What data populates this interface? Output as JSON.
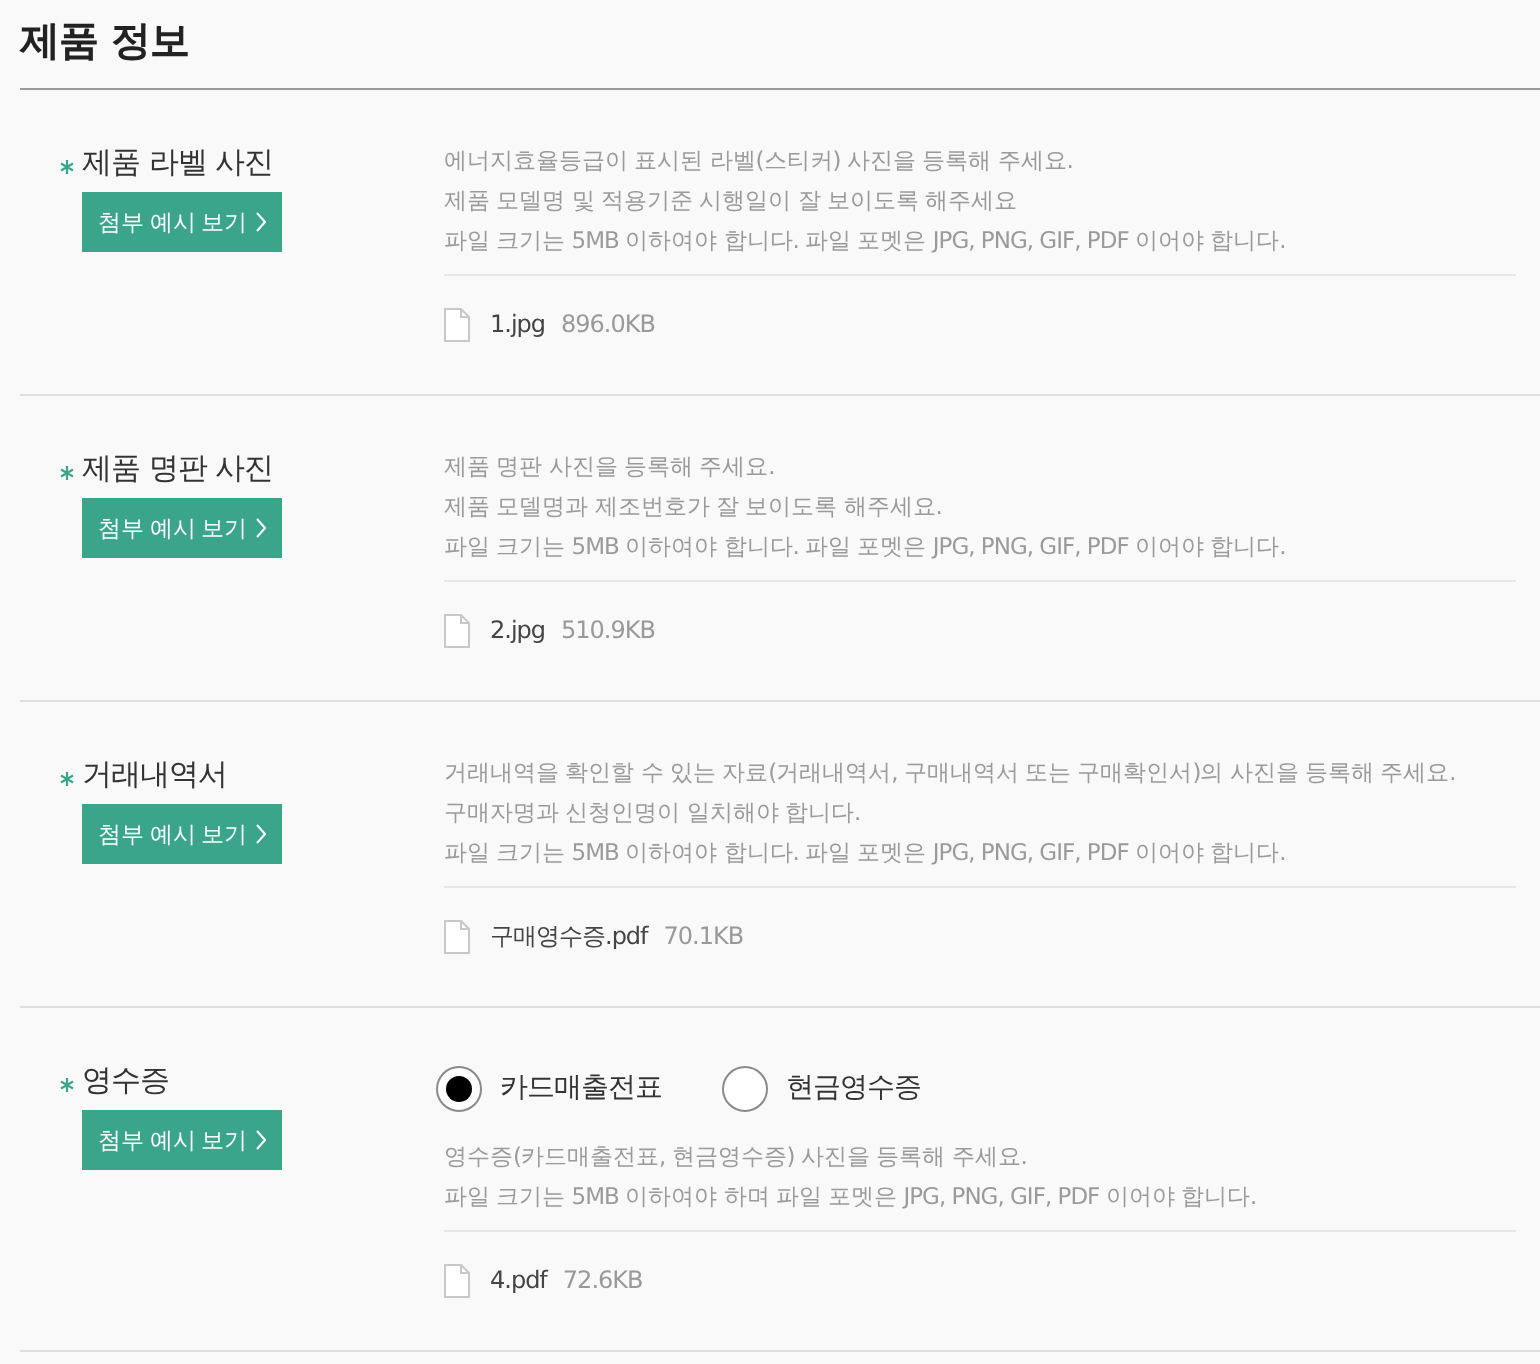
{
  "title": "제품 정보",
  "sections": [
    {
      "kind": "upload",
      "required": true,
      "label": "제품 라벨 사진",
      "example_button": "첨부 예시 보기",
      "description": [
        "에너지효율등급이 표시된 라벨(스티커) 사진을 등록해 주세요.",
        "제품 모델명 및 적용기준 시행일이 잘 보이도록 해주세요",
        "파일 크기는 5MB 이하여야 합니다. 파일 포멧은 JPG, PNG, GIF, PDF 이어야 합니다."
      ],
      "file": {
        "name": "1.jpg",
        "size": "896.0KB"
      }
    },
    {
      "kind": "upload",
      "required": true,
      "label": "제품 명판 사진",
      "example_button": "첨부 예시 보기",
      "description": [
        "제품 명판 사진을 등록해 주세요.",
        "제품 모델명과 제조번호가 잘 보이도록 해주세요.",
        "파일 크기는 5MB 이하여야 합니다. 파일 포멧은 JPG, PNG, GIF, PDF 이어야 합니다."
      ],
      "file": {
        "name": "2.jpg",
        "size": "510.9KB"
      }
    },
    {
      "kind": "upload",
      "required": true,
      "label": "거래내역서",
      "example_button": "첨부 예시 보기",
      "description": [
        "거래내역을 확인할 수 있는 자료(거래내역서, 구매내역서 또는 구매확인서)의 사진을 등록해 주세요.",
        "구매자명과 신청인명이 일치해야 합니다.",
        "파일 크기는 5MB 이하여야 합니다. 파일 포멧은 JPG, PNG, GIF, PDF 이어야 합니다."
      ],
      "file": {
        "name": "구매영수증.pdf",
        "size": "70.1KB"
      }
    },
    {
      "kind": "choice",
      "required": true,
      "label": "영수증",
      "example_button": "첨부 예시 보기",
      "options": [
        {
          "label": "카드매출전표",
          "selected": true
        },
        {
          "label": "현금영수증",
          "selected": false
        }
      ],
      "description": [
        "영수증(카드매출전표, 현금영수증) 사진을 등록해 주세요.",
        "파일 크기는 5MB 이하여야 하며 파일 포멧은 JPG, PNG, GIF, PDF 이어야 합니다."
      ],
      "file": {
        "name": "4.pdf",
        "size": "72.6KB"
      }
    }
  ]
}
